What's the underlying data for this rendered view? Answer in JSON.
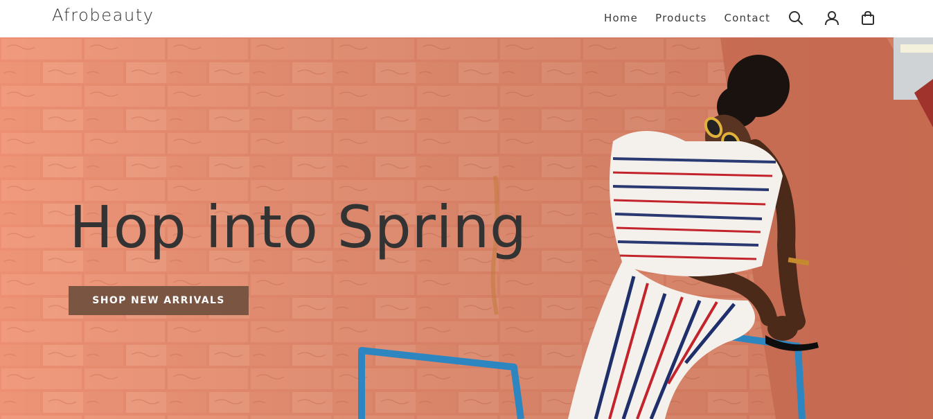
{
  "header": {
    "brand": "Afrobeauty",
    "nav": [
      {
        "label": "Home"
      },
      {
        "label": "Products"
      },
      {
        "label": "Contact"
      }
    ],
    "icons": [
      "search-icon",
      "account-icon",
      "shopping-bag-icon"
    ]
  },
  "hero": {
    "title": "Hop into Spring",
    "cta_label": "SHOP NEW ARRIVALS",
    "image": "woman-in-striped-outfit-against-brick-wall"
  },
  "colors": {
    "cta_background": "#7a5541",
    "title_text": "#333333",
    "wall": "#e98b6e"
  }
}
